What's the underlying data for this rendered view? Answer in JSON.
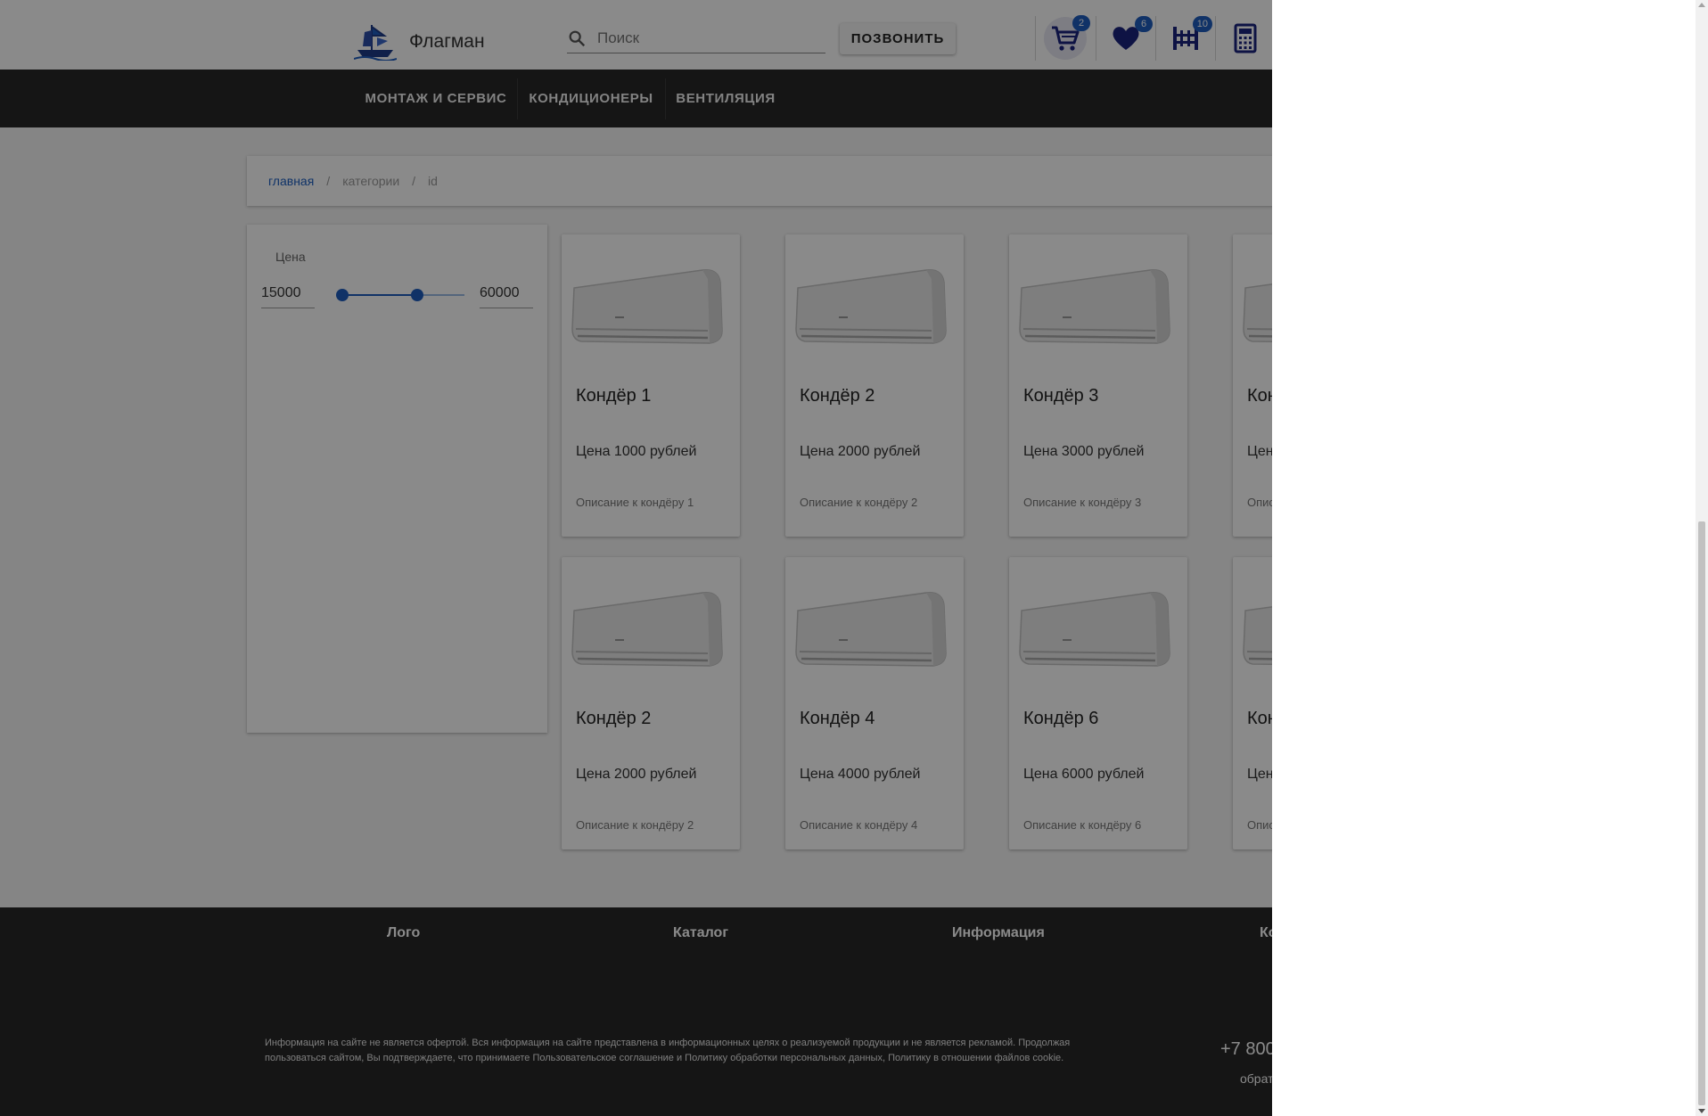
{
  "header": {
    "logo_text": "Флагман",
    "search_placeholder": "Поиск",
    "call_button": "ПОЗВОНИТЬ",
    "icons": [
      {
        "name": "cart-icon",
        "badge": "2"
      },
      {
        "name": "heart-icon",
        "badge": "6"
      },
      {
        "name": "compare-icon",
        "badge": "10"
      },
      {
        "name": "calculator-icon",
        "badge": ""
      }
    ]
  },
  "nav": {
    "items": [
      "МОНТАЖ И СЕРВИС",
      "КОНДИЦИОНЕРЫ",
      "ВЕНТИЛЯЦИЯ"
    ]
  },
  "breadcrumb": {
    "home": "главная",
    "separator": "/",
    "categories": "категории",
    "current": "id"
  },
  "filter": {
    "title": "Цена",
    "min_value": "15000",
    "max_value": "60000",
    "slider_low_fraction": 0.05,
    "slider_high_fraction": 0.63
  },
  "products": [
    {
      "title": "Кондёр 1",
      "price": "Цена 1000 рублей",
      "description": "Описание к кондёру 1"
    },
    {
      "title": "Кондёр 2",
      "price": "Цена 2000 рублей",
      "description": "Описание к кондёру 2"
    },
    {
      "title": "Кондёр 3",
      "price": "Цена 3000 рублей",
      "description": "Описание к кондёру 3"
    },
    {
      "title": "Кон",
      "price": "Цен",
      "description": "Опис"
    },
    {
      "title": "Кондёр 2",
      "price": "Цена 2000 рублей",
      "description": "Описание к кондёру 2"
    },
    {
      "title": "Кондёр 4",
      "price": "Цена 4000 рублей",
      "description": "Описание к кондёру 4"
    },
    {
      "title": "Кондёр 6",
      "price": "Цена 6000 рублей",
      "description": "Описание к кондёру 6"
    },
    {
      "title": "Кон",
      "price": "Цен",
      "description": "Опис"
    }
  ],
  "footer": {
    "columns": [
      "Лого",
      "Каталог",
      "Информация",
      "Ко"
    ],
    "legal": "Информация на сайте не является офертой. Вся информация на сайте представлена в информационных целях о реализуемой продукции и не является рекламой. Продолжая пользоваться сайтом, Вы подтверждаете, что принимаете Пользовательское соглашение и Политику обработки персональных данных, Политику в отношении файлов cookie.",
    "phone": "+7 800",
    "callback": "обрат"
  },
  "colors": {
    "accent": "#1e5dbe",
    "navbar": "#272727",
    "footer": "#272727"
  }
}
